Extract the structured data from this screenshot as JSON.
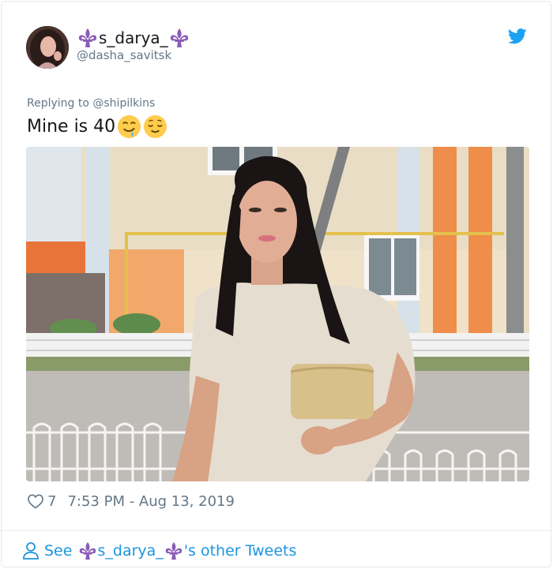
{
  "header": {
    "display_name": "s_darya_",
    "handle": "@dasha_savitsk",
    "logo_icon": "twitter-bird-icon"
  },
  "reply": {
    "prefix": "Replying to",
    "handle": "@shipilkins"
  },
  "tweet": {
    "text": "Mine is 40",
    "emojis": [
      "drooling-face-icon",
      "relieved-face-icon"
    ]
  },
  "meta": {
    "likes": "7",
    "timestamp": "7:53 PM - Aug 13, 2019"
  },
  "footer": {
    "see_label": "See",
    "name": "s_darya_",
    "suffix": "'s other Tweets"
  },
  "colors": {
    "twitter_blue": "#1da1f2",
    "link_blue": "#1b95e0",
    "fleur_purple": "#8b5cb8",
    "secondary_text": "#657786"
  }
}
